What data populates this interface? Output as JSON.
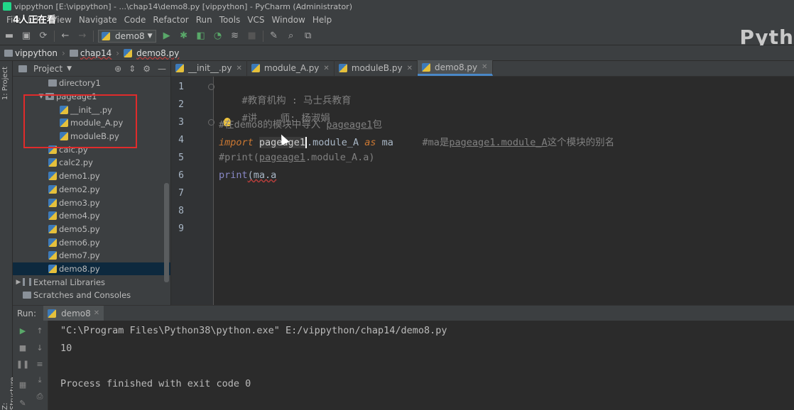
{
  "window": {
    "title": "vippython [E:\\vippython] - ...\\chap14\\demo8.py [vippython] - PyCharm (Administrator)",
    "overlay": "4人正在看",
    "logo_text": "Pyth"
  },
  "menu": [
    "File",
    "Edit",
    "View",
    "Navigate",
    "Code",
    "Refactor",
    "Run",
    "Tools",
    "VCS",
    "Window",
    "Help"
  ],
  "toolbar": {
    "run_config": "demo8"
  },
  "breadcrumb": [
    "vippython",
    "chap14",
    "demo8.py"
  ],
  "project": {
    "title": "Project",
    "tree": [
      {
        "label": "directory1",
        "kind": "folder",
        "indent": 1
      },
      {
        "label": "pageage1",
        "kind": "package",
        "indent": 1,
        "expanded": true
      },
      {
        "label": "__init__.py",
        "kind": "py",
        "indent": 2
      },
      {
        "label": "module_A.py",
        "kind": "py",
        "indent": 2
      },
      {
        "label": "moduleB.py",
        "kind": "py",
        "indent": 2
      },
      {
        "label": "calc.py",
        "kind": "py",
        "indent": 1
      },
      {
        "label": "calc2.py",
        "kind": "py",
        "indent": 1
      },
      {
        "label": "demo1.py",
        "kind": "py",
        "indent": 1
      },
      {
        "label": "demo2.py",
        "kind": "py",
        "indent": 1
      },
      {
        "label": "demo3.py",
        "kind": "py",
        "indent": 1
      },
      {
        "label": "demo4.py",
        "kind": "py",
        "indent": 1
      },
      {
        "label": "demo5.py",
        "kind": "py",
        "indent": 1
      },
      {
        "label": "demo6.py",
        "kind": "py",
        "indent": 1
      },
      {
        "label": "demo7.py",
        "kind": "py",
        "indent": 1
      },
      {
        "label": "demo8.py",
        "kind": "py",
        "indent": 1,
        "selected": true
      },
      {
        "label": "External Libraries",
        "kind": "lib",
        "indent": 0
      },
      {
        "label": "Scratches and Consoles",
        "kind": "scratch",
        "indent": 0
      }
    ]
  },
  "tabs": [
    "__init__.py",
    "module_A.py",
    "moduleB.py",
    "demo8.py"
  ],
  "active_tab": "demo8.py",
  "editor": {
    "line_numbers": [
      "1",
      "2",
      "3",
      "4",
      "5",
      "6",
      "7",
      "8",
      "9"
    ],
    "lines": {
      "l1": "#教育机构 : 马士兵教育",
      "l2": "#讲    师: 杨淑娟",
      "l3_a": "#在demo8的模块中导入 ",
      "l3_pkg": "pageage1",
      "l3_b": "包",
      "l4_import": "import",
      "l4_pkg_sel": "pageage1",
      "l4_mod": ".module_A ",
      "l4_as": "as",
      "l4_alias": " ma",
      "l4_comment_a": "     #ma是",
      "l4_comment_pkg": "pageage1.module_A",
      "l4_comment_b": "这个模块的别名",
      "l5_a": "#print(",
      "l5_pkg": "pageage1",
      "l5_b": ".module_A.a)",
      "l6_print": "print",
      "l6_rest": "(ma.a"
    }
  },
  "run": {
    "label": "Run:",
    "tab": "demo8",
    "output": [
      "\"C:\\Program Files\\Python38\\python.exe\" E:/vippython/chap14/demo8.py",
      "10",
      "",
      "Process finished with exit code 0"
    ]
  },
  "side_tabs": {
    "project": "1: Project",
    "structure": "Z: Structure"
  }
}
